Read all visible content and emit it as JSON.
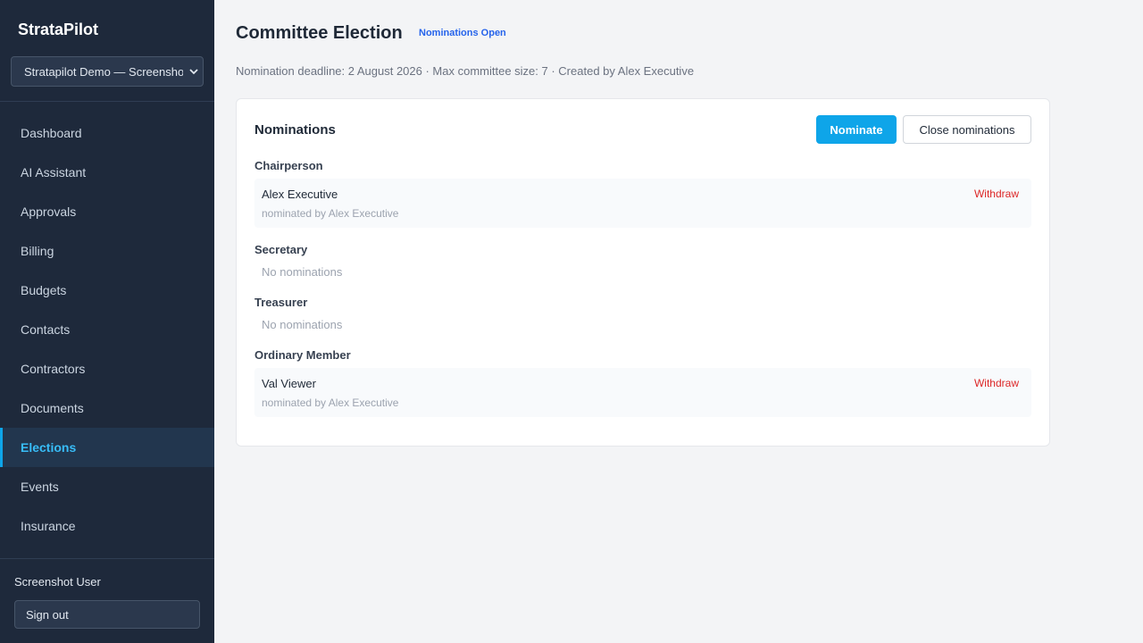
{
  "app": {
    "name": "StrataPilot"
  },
  "org_select": {
    "value": "Stratapilot Demo — Screenshot"
  },
  "nav": {
    "items": [
      {
        "label": "Dashboard"
      },
      {
        "label": "AI Assistant"
      },
      {
        "label": "Approvals"
      },
      {
        "label": "Billing"
      },
      {
        "label": "Budgets"
      },
      {
        "label": "Contacts"
      },
      {
        "label": "Contractors"
      },
      {
        "label": "Documents"
      },
      {
        "label": "Elections",
        "active": true
      },
      {
        "label": "Events"
      },
      {
        "label": "Insurance"
      }
    ]
  },
  "user": {
    "name": "Screenshot User",
    "signout_label": "Sign out"
  },
  "page": {
    "title": "Committee Election",
    "status": "Nominations Open",
    "meta": "Nomination deadline: 2 August 2026 · Max committee size: 7 · Created by Alex Executive"
  },
  "nominations": {
    "title": "Nominations",
    "nominate_label": "Nominate",
    "close_label": "Close nominations",
    "withdraw_label": "Withdraw",
    "empty_label": "No nominations",
    "roles": [
      {
        "role": "Chairperson",
        "nominees": [
          {
            "name": "Alex Executive",
            "nominated_by": "nominated by Alex Executive"
          }
        ]
      },
      {
        "role": "Secretary",
        "nominees": []
      },
      {
        "role": "Treasurer",
        "nominees": []
      },
      {
        "role": "Ordinary Member",
        "nominees": [
          {
            "name": "Val Viewer",
            "nominated_by": "nominated by Alex Executive"
          }
        ]
      }
    ]
  },
  "colors": {
    "sidebar": "#1e293b",
    "accent": "#0ea5e9",
    "danger": "#dc2626",
    "status": "#2563eb"
  }
}
